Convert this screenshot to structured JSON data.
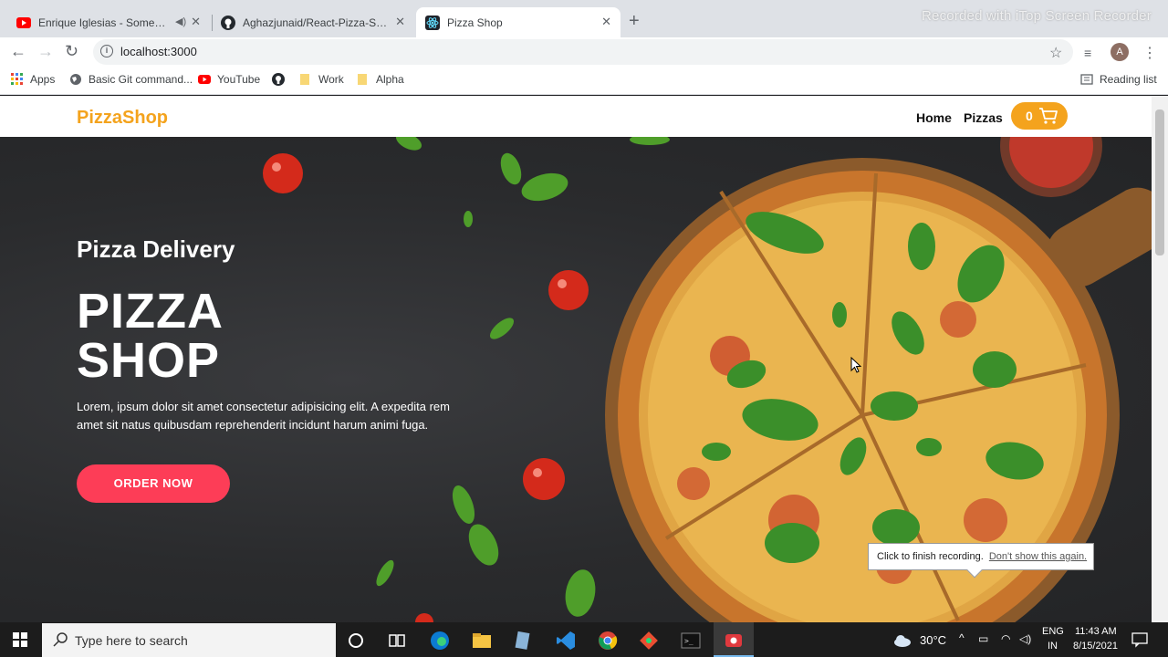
{
  "browser": {
    "tabs": [
      {
        "title": "Enrique Iglesias - Somebody",
        "icon": "youtube-icon",
        "active": false
      },
      {
        "title": "Aghazjunaid/React-Pizza-Shop",
        "icon": "github-icon",
        "active": false
      },
      {
        "title": "Pizza Shop",
        "icon": "react-icon",
        "active": true
      }
    ],
    "recording_watermark": "Recorded with iTop Screen Recorder",
    "url": "localhost:3000",
    "profile_initial": "A",
    "bookmarks": [
      {
        "label": "Apps",
        "icon": "apps-grid-icon"
      },
      {
        "label": "Basic Git command...",
        "icon": "globe-icon"
      },
      {
        "label": "YouTube",
        "icon": "youtube-icon"
      },
      {
        "label": "",
        "icon": "github-icon"
      },
      {
        "label": "Work",
        "icon": "folder-icon"
      },
      {
        "label": "Alpha",
        "icon": "folder-icon"
      }
    ],
    "reading_list": "Reading list"
  },
  "site": {
    "brand": "PizzaShop",
    "nav": {
      "home": "Home",
      "pizzas": "Pizzas"
    },
    "cart_count": "0",
    "colors": {
      "accent": "#f4a31d",
      "cta": "#fd3d57"
    }
  },
  "hero": {
    "subtitle": "Pizza Delivery",
    "title_line1": "PIZZA",
    "title_line2": "SHOP",
    "text": "Lorem, ipsum dolor sit amet consectetur adipisicing elit. A expedita rem amet sit natus quibusdam reprehenderit incidunt harum animi fuga.",
    "cta": "ORDER NOW"
  },
  "recorder_tooltip": {
    "message": "Click to finish recording.",
    "link": "Don't show this again."
  },
  "taskbar": {
    "search_placeholder": "Type here to search",
    "temperature": "30°C",
    "language": "ENG",
    "region": "IN",
    "time": "11:43 AM",
    "date": "8/15/2021"
  }
}
